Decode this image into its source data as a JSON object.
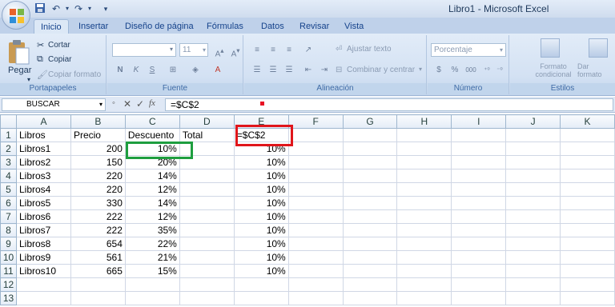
{
  "title": "Libro1 - Microsoft Excel",
  "tabs": [
    "Inicio",
    "Insertar",
    "Diseño de página",
    "Fórmulas",
    "Datos",
    "Revisar",
    "Vista"
  ],
  "ribbon": {
    "clipboard": {
      "paste": "Pegar",
      "cut": "Cortar",
      "copy": "Copiar",
      "format_painter": "Copiar formato",
      "label": "Portapapeles"
    },
    "font": {
      "font_size": "11",
      "bold": "N",
      "italic": "K",
      "underline": "S",
      "label": "Fuente"
    },
    "alignment": {
      "wrap": "Ajustar texto",
      "merge": "Combinar y centrar",
      "label": "Alineación"
    },
    "number": {
      "format": "Porcentaje",
      "currency": "$",
      "percent": "%",
      "thousands": "000",
      "label": "Número"
    },
    "styles": {
      "conditional": "Formato condicional",
      "table": "Dar formato como tabla",
      "label": "Estilos"
    }
  },
  "formula_bar": {
    "name_box": "BUSCAR",
    "formula": "=$C$2"
  },
  "sheet": {
    "columns": [
      "A",
      "B",
      "C",
      "D",
      "E",
      "F",
      "G",
      "H",
      "I",
      "J",
      "K"
    ],
    "rows": [
      [
        "Libros",
        "Precio",
        "Descuento",
        "Total",
        "=$C$2"
      ],
      [
        "Libros1",
        "200",
        "10%",
        "",
        "10%"
      ],
      [
        "Libros2",
        "150",
        "20%",
        "",
        "10%"
      ],
      [
        "Libros3",
        "220",
        "14%",
        "",
        "10%"
      ],
      [
        "Libros4",
        "220",
        "12%",
        "",
        "10%"
      ],
      [
        "Libros5",
        "330",
        "14%",
        "",
        "10%"
      ],
      [
        "Libros6",
        "222",
        "12%",
        "",
        "10%"
      ],
      [
        "Libros7",
        "222",
        "35%",
        "",
        "10%"
      ],
      [
        "Libros8",
        "654",
        "22%",
        "",
        "10%"
      ],
      [
        "Libros9",
        "561",
        "21%",
        "",
        "10%"
      ],
      [
        "Libros10",
        "665",
        "15%",
        "",
        "10%"
      ],
      [
        "",
        "",
        "",
        "",
        ""
      ],
      [
        "",
        "",
        "",
        "",
        ""
      ]
    ]
  }
}
